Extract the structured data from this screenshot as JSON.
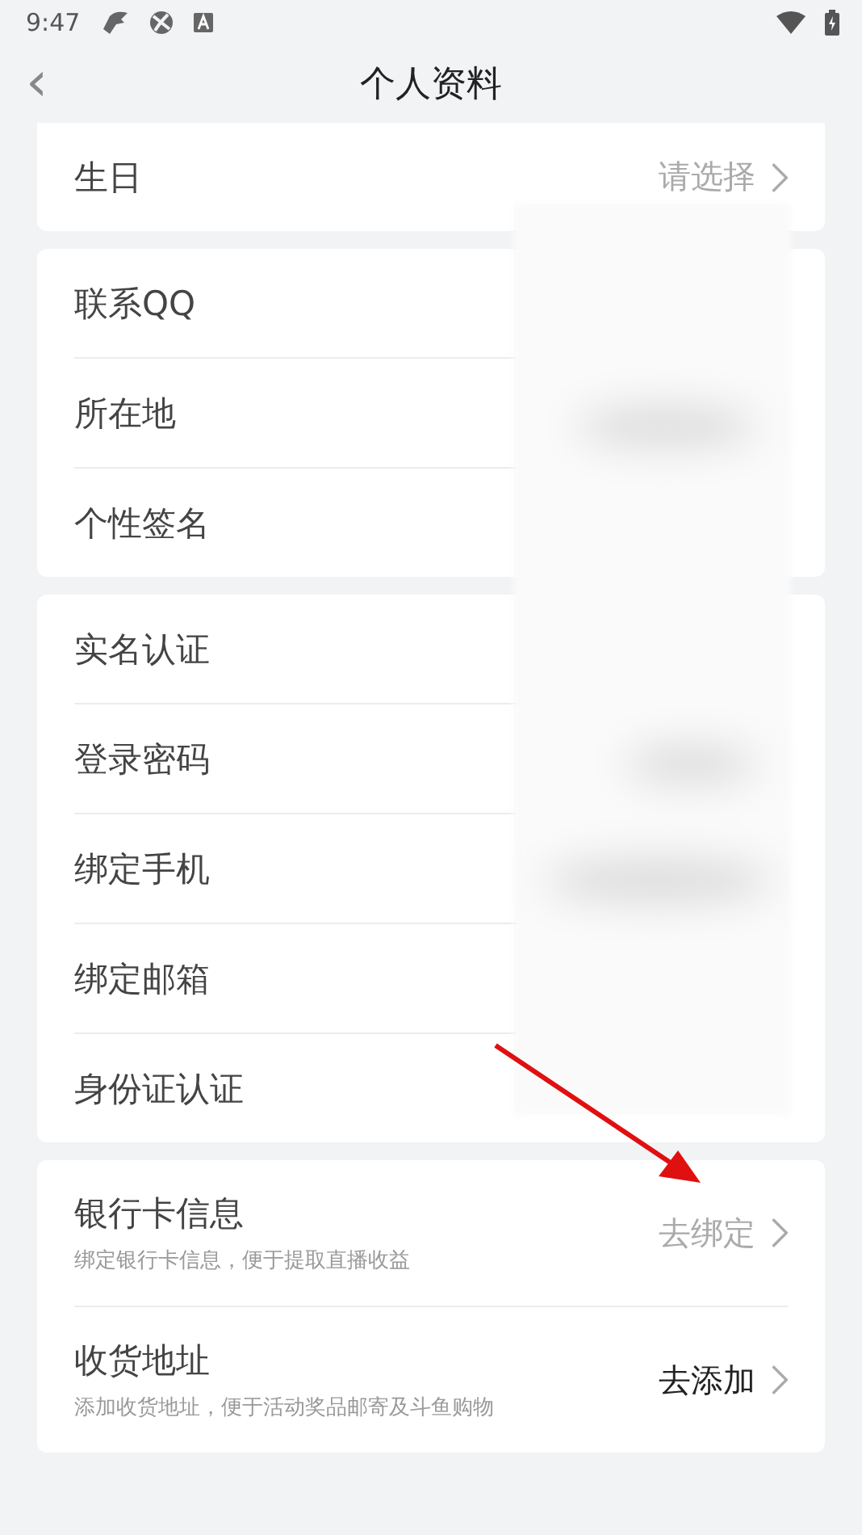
{
  "status_bar": {
    "time": "9:47"
  },
  "header": {
    "back": "‹",
    "title": "个人资料"
  },
  "groups": [
    {
      "items": [
        {
          "label": "生日",
          "value": "请选择",
          "chevron": true,
          "dimmed": true
        }
      ]
    },
    {
      "items": [
        {
          "label": "联系QQ"
        },
        {
          "label": "所在地"
        },
        {
          "label": "个性签名"
        }
      ]
    },
    {
      "items": [
        {
          "label": "实名认证"
        },
        {
          "label": "登录密码"
        },
        {
          "label": "绑定手机"
        },
        {
          "label": "绑定邮箱"
        },
        {
          "label": "身份证认证"
        }
      ]
    },
    {
      "items": [
        {
          "label": "银行卡信息",
          "subtitle": "绑定银行卡信息，便于提取直播收益",
          "value": "去绑定",
          "chevron": true,
          "dimmed": true
        },
        {
          "label": "收货地址",
          "subtitle": "添加收货地址，便于活动奖品邮寄及斗鱼购物",
          "value": "去添加",
          "chevron": true,
          "dimmed": false
        }
      ]
    }
  ]
}
